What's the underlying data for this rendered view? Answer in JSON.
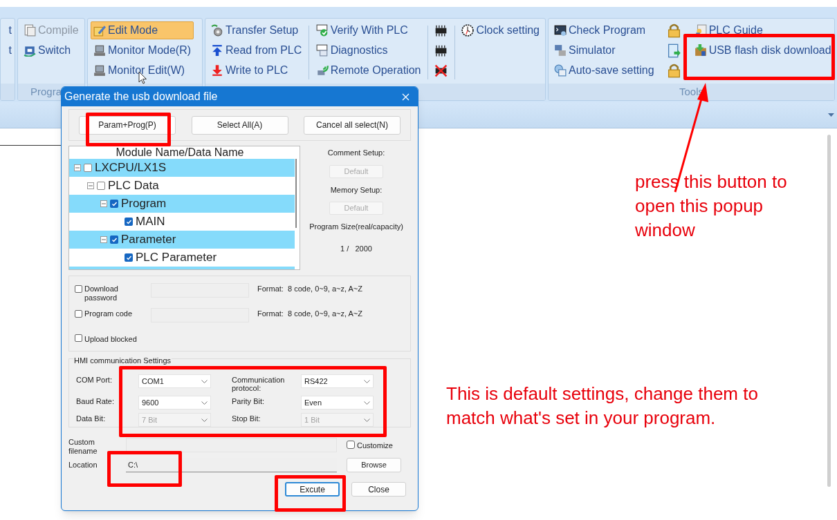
{
  "ribbon": {
    "groups": [
      {
        "columns": [
          [
            {
              "label": "t"
            },
            {
              "label": "t"
            }
          ]
        ]
      },
      {
        "label": "Progra",
        "columns": [
          [
            {
              "label": "Compile",
              "disabled": true,
              "selected": false
            },
            {
              "label": "Switch",
              "disabled": false,
              "selected": false
            }
          ]
        ]
      },
      {
        "columns": [
          [
            {
              "label": "Edit Mode",
              "disabled": false,
              "selected": true
            },
            {
              "label": "Monitor Mode(R)",
              "disabled": false,
              "selected": false
            },
            {
              "label": "Monitor Edit(W)",
              "disabled": false,
              "selected": false
            }
          ]
        ]
      },
      {
        "columns": [
          [
            {
              "label": "Transfer Setup",
              "disabled": false,
              "selected": false
            },
            {
              "label": "Read from PLC",
              "disabled": false,
              "selected": false
            },
            {
              "label": "Write to PLC",
              "disabled": false,
              "selected": false
            }
          ],
          [
            {
              "label": "Verify With PLC",
              "disabled": false,
              "selected": false
            },
            {
              "label": "Diagnostics",
              "disabled": false,
              "selected": false
            },
            {
              "label": "Remote Operation",
              "disabled": false,
              "selected": false
            }
          ],
          [
            {
              "kind": "icon"
            },
            {
              "kind": "icon"
            },
            {
              "kind": "icon"
            }
          ],
          [
            {
              "label": "Clock setting",
              "disabled": false,
              "selected": false
            }
          ]
        ]
      },
      {
        "label": "Tools",
        "columns": [
          [
            {
              "label": "Check Program",
              "disabled": false,
              "selected": false
            },
            {
              "label": "Simulator",
              "disabled": false,
              "selected": false
            },
            {
              "label": "Auto-save setting",
              "disabled": false,
              "selected": false
            }
          ],
          [
            {
              "kind": "icon"
            },
            {
              "kind": "icon"
            },
            {
              "kind": "icon"
            }
          ],
          [
            {
              "label": "PLC Guide",
              "disabled": false,
              "selected": false
            },
            {
              "label": "USB flash disk download",
              "disabled": false,
              "selected": false
            }
          ]
        ]
      }
    ]
  },
  "dialog": {
    "title": "Generate the usb download file",
    "top_buttons": [
      "Param+Prog(P)",
      "Select All(A)",
      "Cancel all select(N)"
    ],
    "tree": {
      "header": "Module Name/Data Name",
      "items": [
        {
          "label": "LXCPU/LX1S",
          "checked": false,
          "expanded": true,
          "children": [
            {
              "label": "PLC Data",
              "checked": false,
              "expanded": true,
              "children": [
                {
                  "label": "Program",
                  "checked": true,
                  "expanded": true,
                  "children": [
                    {
                      "label": "MAIN",
                      "checked": true
                    }
                  ]
                },
                {
                  "label": "Parameter",
                  "checked": true,
                  "expanded": true,
                  "children": [
                    {
                      "label": "PLC Parameter",
                      "checked": true
                    }
                  ]
                }
              ]
            }
          ]
        }
      ]
    },
    "side": [
      {
        "kind": "label",
        "text": "Comment Setup:"
      },
      {
        "kind": "button",
        "text": "Default",
        "disabled": true
      },
      {
        "kind": "label",
        "text": "Memory Setup:"
      },
      {
        "kind": "button",
        "text": "Default",
        "disabled": true
      },
      {
        "kind": "label",
        "text": "Program Size(real/capacity)"
      },
      {
        "kind": "value",
        "text": "1 /   2000"
      }
    ],
    "security": [
      {
        "label": "Download password",
        "checked": false,
        "has_field": true,
        "format": "Format:  8 code, 0~9, a~z, A~Z"
      },
      {
        "label": "Program code",
        "checked": false,
        "has_field": true,
        "format": "Format:  8 code, 0~9, a~z, A~Z"
      },
      {
        "label": "Upload blocked",
        "checked": false,
        "has_field": false
      }
    ],
    "hmi": {
      "legend": "HMI communication Settings",
      "fields": [
        {
          "label": "COM Port:",
          "value": "COM1",
          "disabled": false
        },
        {
          "label": "Communication protocol:",
          "value": "RS422",
          "disabled": false
        },
        {
          "label": "Baud Rate:",
          "value": "9600",
          "disabled": false
        },
        {
          "label": "Parity Bit:",
          "value": "Even",
          "disabled": false
        },
        {
          "label": "Data Bit:",
          "value": "7 Bit",
          "disabled": true
        },
        {
          "label": "Stop Bit:",
          "value": "1 Bit",
          "disabled": true
        }
      ]
    },
    "custom_filename": {
      "label": "Custom filename",
      "checkbox": "Customize",
      "checked": false
    },
    "location": {
      "label": "Location",
      "value": "C:\\",
      "button": "Browse"
    },
    "bottom_buttons": [
      {
        "label": "Excute",
        "focused": true
      },
      {
        "label": "Close",
        "focused": false
      }
    ]
  },
  "notes": [
    "press this button to open this popup window",
    "This is default settings, change them to match what's set in your program."
  ]
}
